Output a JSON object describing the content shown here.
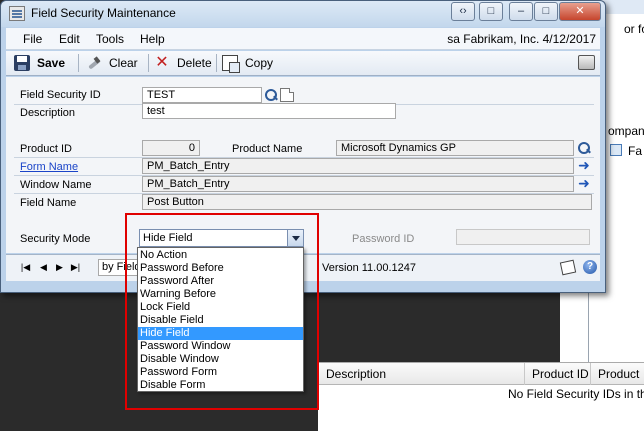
{
  "background_window": {
    "fragment_top": "or form",
    "fragment_mid": "ompan",
    "fragment_row": "Fa",
    "grid_headers": [
      "Description",
      "Product ID",
      "Product"
    ],
    "grid_message": "No Field Security IDs in this"
  },
  "window": {
    "title": "Field Security Maintenance",
    "title_buttons": [
      "‹›",
      "□",
      "–",
      "□",
      "✕"
    ]
  },
  "menu": {
    "items": [
      "File",
      "Edit",
      "Tools",
      "Help"
    ],
    "status": "sa  Fabrikam, Inc.  4/12/2017"
  },
  "toolbar": {
    "save": "Save",
    "clear": "Clear",
    "delete": "Delete",
    "copy": "Copy"
  },
  "form": {
    "field_security_id_label": "Field Security ID",
    "field_security_id_value": "TEST",
    "description_label": "Description",
    "description_value": "test",
    "product_id_label": "Product ID",
    "product_id_value": "0",
    "product_name_label": "Product Name",
    "product_name_value": "Microsoft Dynamics GP",
    "form_name_label": "Form Name",
    "form_name_value": "PM_Batch_Entry",
    "window_name_label": "Window Name",
    "window_name_value": "PM_Batch_Entry",
    "field_name_label": "Field Name",
    "field_name_value": "Post Button",
    "security_mode_label": "Security Mode",
    "security_mode_value": "Hide Field",
    "password_id_label": "Password ID",
    "password_id_value": ""
  },
  "statusbar": {
    "nav": [
      "|◀",
      "◀",
      "▶",
      "▶|"
    ],
    "sort_value": "by Field",
    "version": "Version 11.00.1247",
    "help_glyph": "?"
  },
  "dropdown": {
    "options": [
      "No Action",
      "Password Before",
      "Password After",
      "Warning Before",
      "Lock Field",
      "Disable Field",
      "Hide Field",
      "Password Window",
      "Disable Window",
      "Password Form",
      "Disable Form"
    ],
    "selected": "Hide Field"
  },
  "colors": {
    "window_frame": "#bcd2ea",
    "selection": "#3399ff",
    "link": "#1a44c8",
    "annotation": "#e00000"
  }
}
